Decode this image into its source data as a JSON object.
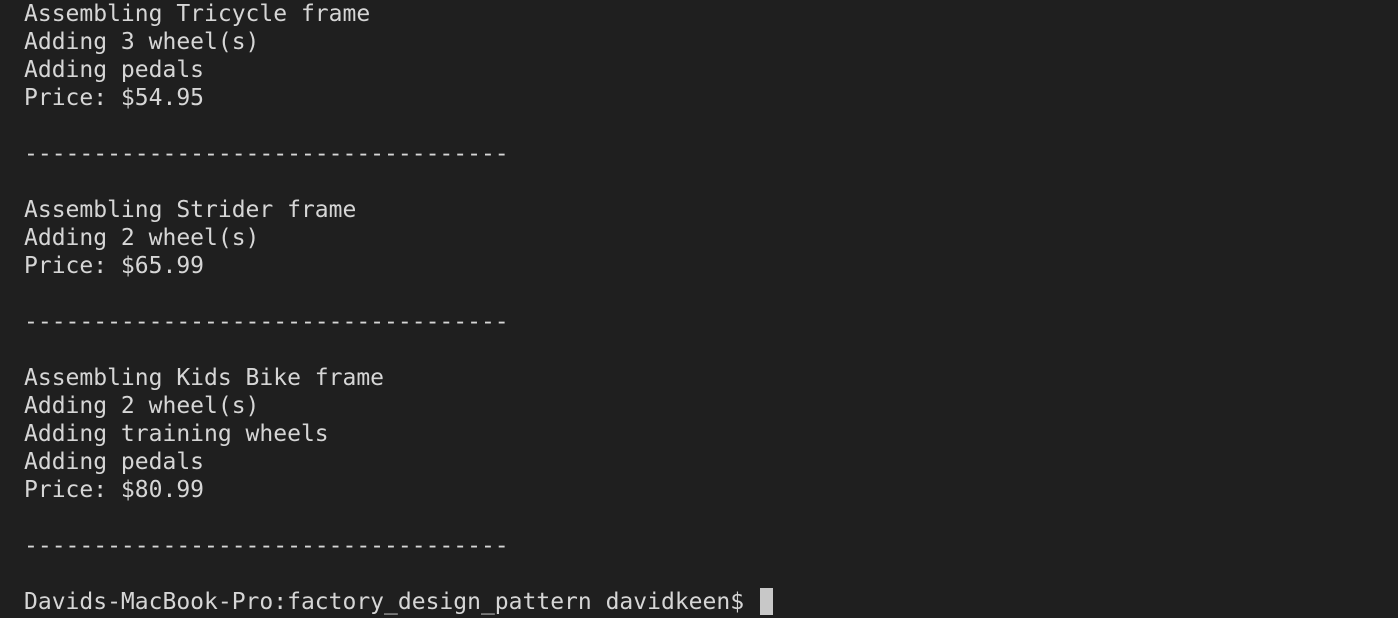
{
  "terminal": {
    "lines": [
      "Assembling Tricycle frame",
      "Adding 3 wheel(s)",
      "Adding pedals",
      "Price: $54.95",
      "",
      "-----------------------------------",
      "",
      "Assembling Strider frame",
      "Adding 2 wheel(s)",
      "Price: $65.99",
      "",
      "-----------------------------------",
      "",
      "Assembling Kids Bike frame",
      "Adding 2 wheel(s)",
      "Adding training wheels",
      "Adding pedals",
      "Price: $80.99",
      "",
      "-----------------------------------",
      "",
      "Davids-MacBook-Pro:factory_design_pattern davidkeen$ "
    ]
  }
}
